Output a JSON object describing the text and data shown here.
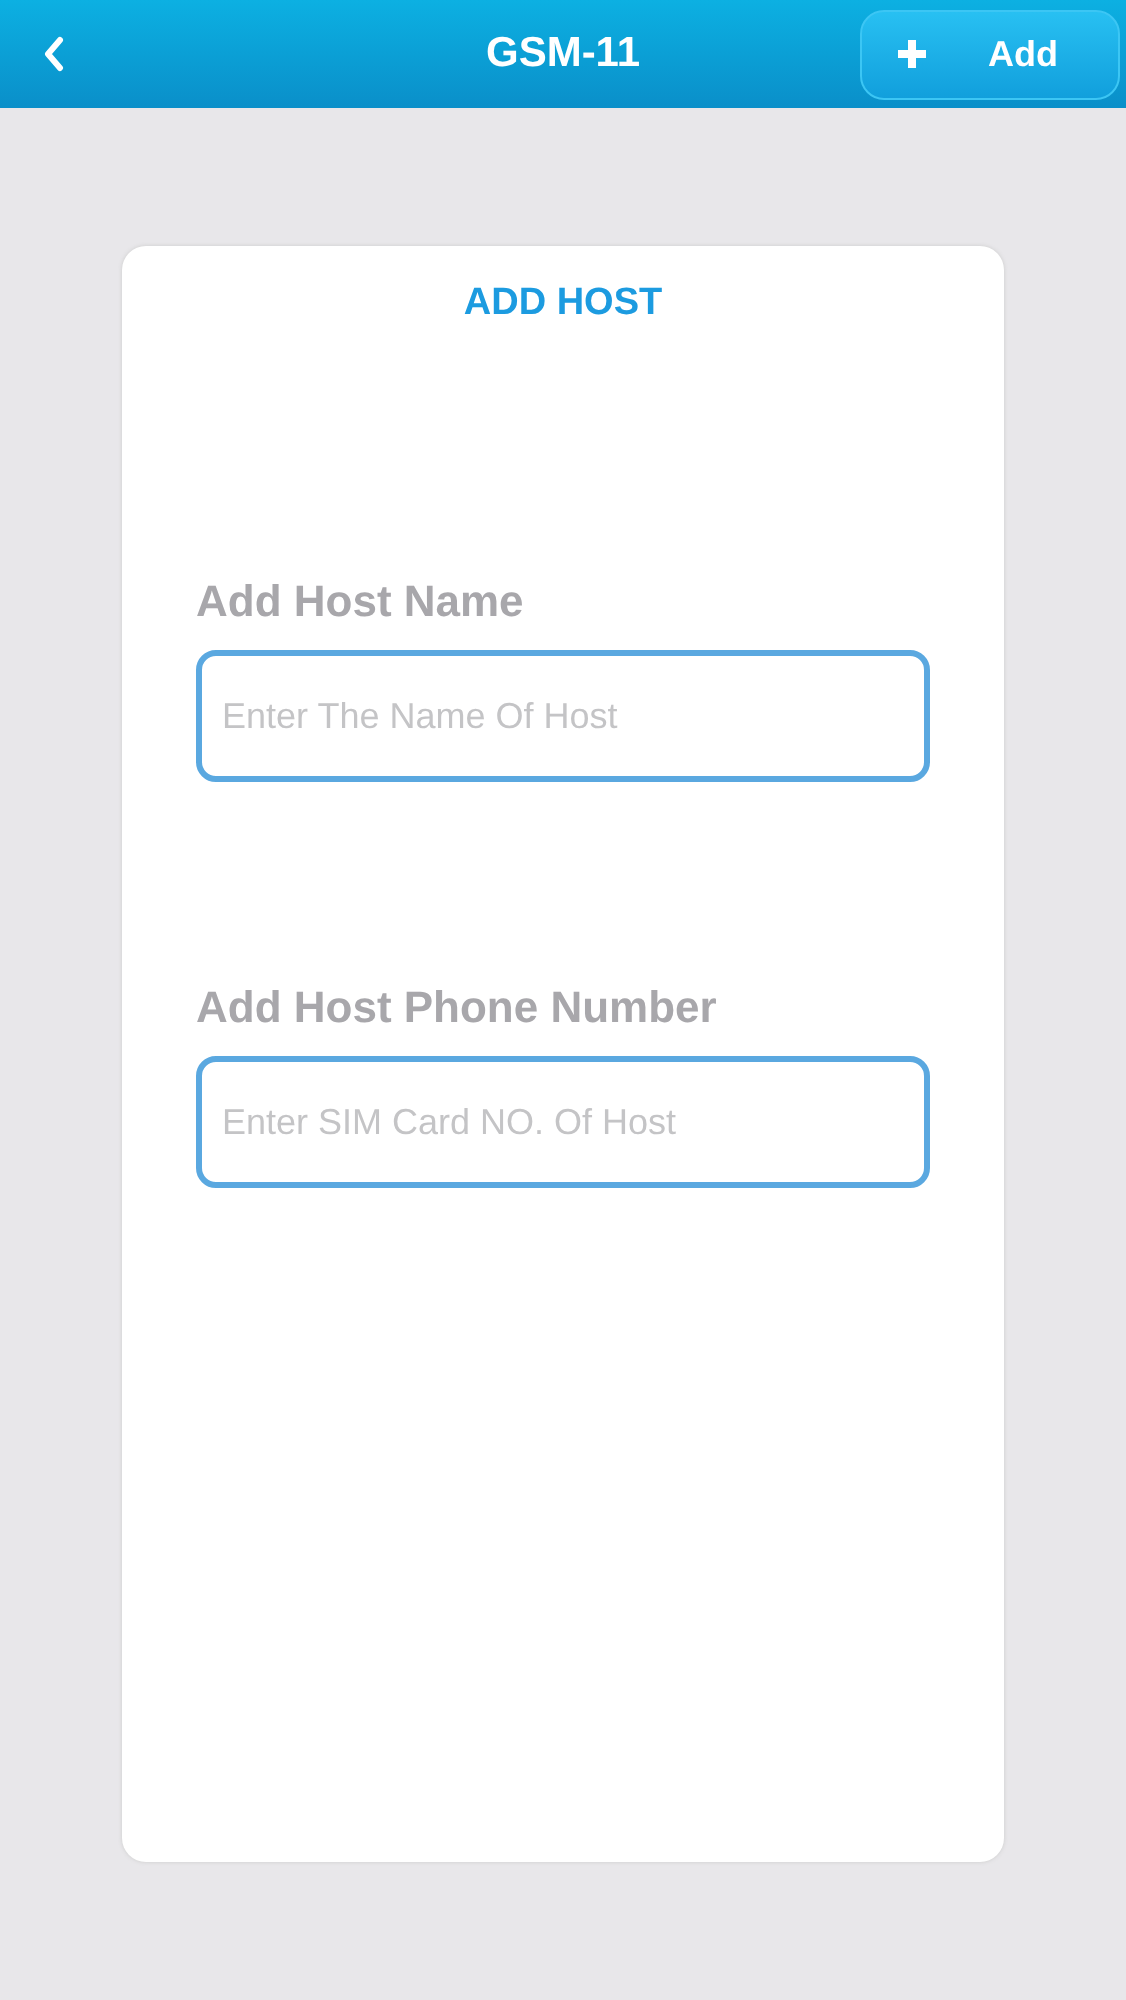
{
  "header": {
    "title": "GSM-11",
    "add_button": {
      "label": "Add"
    }
  },
  "card": {
    "title": "ADD HOST",
    "fields": [
      {
        "label": "Add Host Name",
        "placeholder": "Enter The Name Of Host"
      },
      {
        "label": "Add Host Phone Number",
        "placeholder": "Enter SIM Card NO. Of Host"
      }
    ]
  }
}
